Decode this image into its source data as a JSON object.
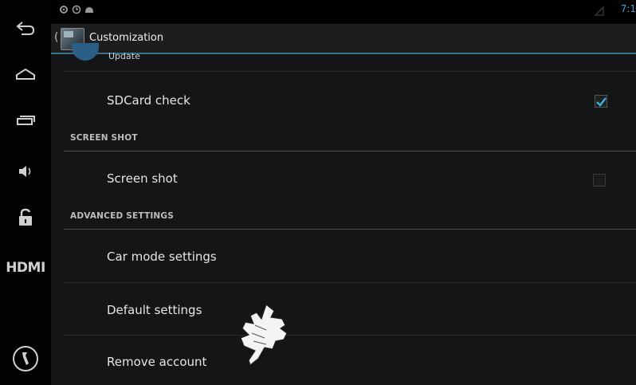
{
  "nav": {
    "buttons": [
      {
        "icon": "back-icon"
      },
      {
        "icon": "home-icon"
      },
      {
        "icon": "recent-apps-icon"
      },
      {
        "icon": "volume-icon"
      },
      {
        "icon": "unlock-icon"
      },
      {
        "icon": "hdmi-label",
        "label": "HDMI"
      },
      {
        "icon": "tools-icon"
      }
    ]
  },
  "status": {
    "time": "7:1",
    "icons": [
      "settings-status-icon",
      "sync-status-icon",
      "android-status-icon",
      "signal-icon"
    ]
  },
  "action_bar": {
    "title": "Customization",
    "accent_color": "#3d6f8c"
  },
  "settings": {
    "partial_item": {
      "label": "Update"
    },
    "sdcard": {
      "label": "SDCard check",
      "checked": true
    },
    "screen_shot_header": "SCREEN SHOT",
    "screen_shot": {
      "label": "Screen shot",
      "checked": false
    },
    "advanced_header": "ADVANCED SETTINGS",
    "car_mode": {
      "label": "Car mode settings"
    },
    "default": {
      "label": "Default settings"
    },
    "remove_account": {
      "label": "Remove account"
    }
  },
  "colors": {
    "checkmark": "#35b5e5",
    "background": "#141517",
    "header_text": "#bdbdbd"
  }
}
